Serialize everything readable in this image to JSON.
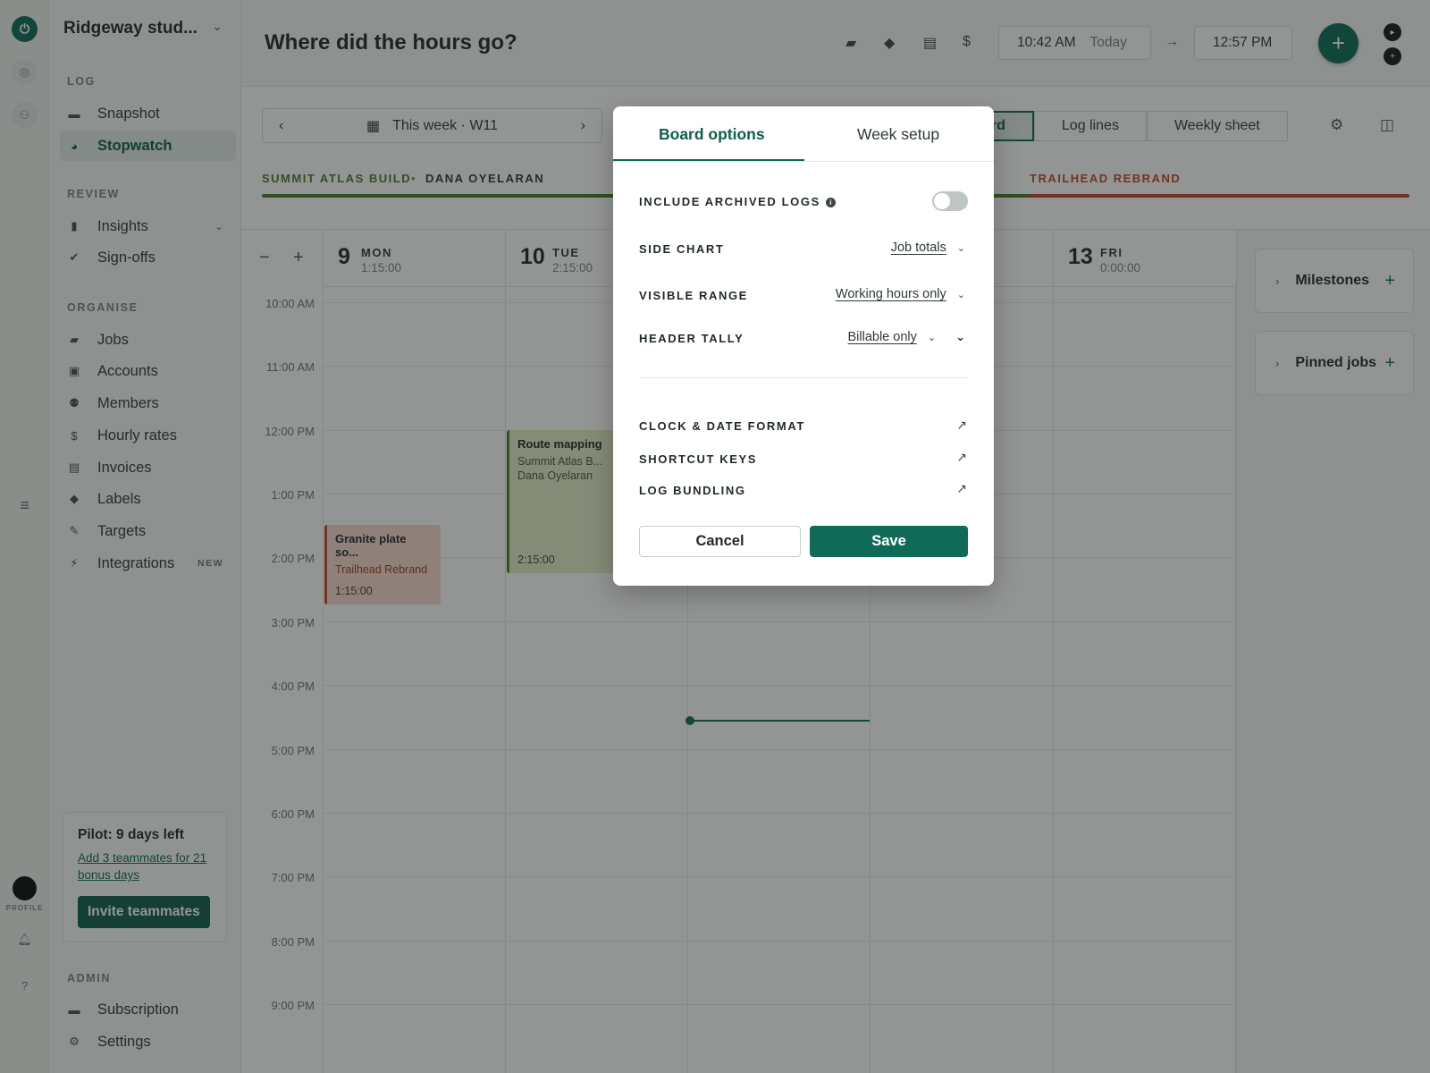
{
  "workspace": {
    "name": "Ridgeway stud..."
  },
  "rail": {
    "profile_label": "PROFILE"
  },
  "sidebar": {
    "sections": {
      "log": "LOG",
      "review": "REVIEW",
      "organise": "ORGANISE",
      "admin": "ADMIN"
    },
    "items": {
      "snapshot": "Snapshot",
      "stopwatch": "Stopwatch",
      "insights": "Insights",
      "signoffs": "Sign-offs",
      "jobs": "Jobs",
      "accounts": "Accounts",
      "members": "Members",
      "hourly_rates": "Hourly rates",
      "invoices": "Invoices",
      "labels": "Labels",
      "targets": "Targets",
      "integrations": "Integrations",
      "integrations_badge": "NEW",
      "subscription": "Subscription",
      "settings": "Settings"
    },
    "pilot": {
      "title": "Pilot: 9 days left",
      "link": "Add 3 teammates for 21 bonus days",
      "button": "Invite teammates"
    }
  },
  "header": {
    "title": "Where did the hours go?",
    "start_time": "10:42 AM",
    "start_day": "Today",
    "end_time": "12:57 PM"
  },
  "toolbar": {
    "week_label": "This week · W11",
    "view_tabs": {
      "board_partial": "ard",
      "log_lines": "Log lines",
      "weekly_sheet": "Weekly sheet"
    },
    "job_bars": {
      "left_job": "SUMMIT ATLAS BUILD",
      "left_person": "DANA OYELARAN",
      "right_job": "TRAILHEAD REBRAND"
    },
    "colors": {
      "summit": "#4c7a2c",
      "trailhead": "#c0462a"
    }
  },
  "calendar": {
    "days": [
      {
        "num": "9",
        "name": "MON",
        "total": "1:15:00"
      },
      {
        "num": "10",
        "name": "TUE",
        "total": "2:15:00"
      },
      {
        "num": "13",
        "name": "FRI",
        "total": "0:00:00"
      }
    ],
    "hours": [
      "10:00 AM",
      "11:00 AM",
      "12:00 PM",
      "1:00 PM",
      "2:00 PM",
      "3:00 PM",
      "4:00 PM",
      "5:00 PM",
      "6:00 PM",
      "7:00 PM",
      "8:00 PM",
      "9:00 PM"
    ],
    "events": {
      "granite": {
        "title": "Granite plate so...",
        "job": "Trailhead Rebrand",
        "duration": "1:15:00"
      },
      "route": {
        "title": "Route mapping",
        "job": "Summit Atlas B...",
        "person": "Dana Oyelaran",
        "duration": "2:15:00"
      }
    }
  },
  "panel": {
    "milestones": "Milestones",
    "pinned_jobs": "Pinned jobs"
  },
  "modal": {
    "tabs": {
      "board_options": "Board options",
      "week_setup": "Week setup"
    },
    "options": {
      "include_archived": "INCLUDE ARCHIVED LOGS",
      "side_chart": "SIDE CHART",
      "side_chart_value": "Job totals",
      "visible_range": "VISIBLE RANGE",
      "visible_range_value": "Working hours only",
      "header_tally": "HEADER TALLY",
      "header_tally_value": "Billable only"
    },
    "links": {
      "clock_date": "CLOCK & DATE FORMAT",
      "shortcut_keys": "SHORTCUT KEYS",
      "log_bundling": "LOG BUNDLING"
    },
    "cancel": "Cancel",
    "save": "Save"
  }
}
